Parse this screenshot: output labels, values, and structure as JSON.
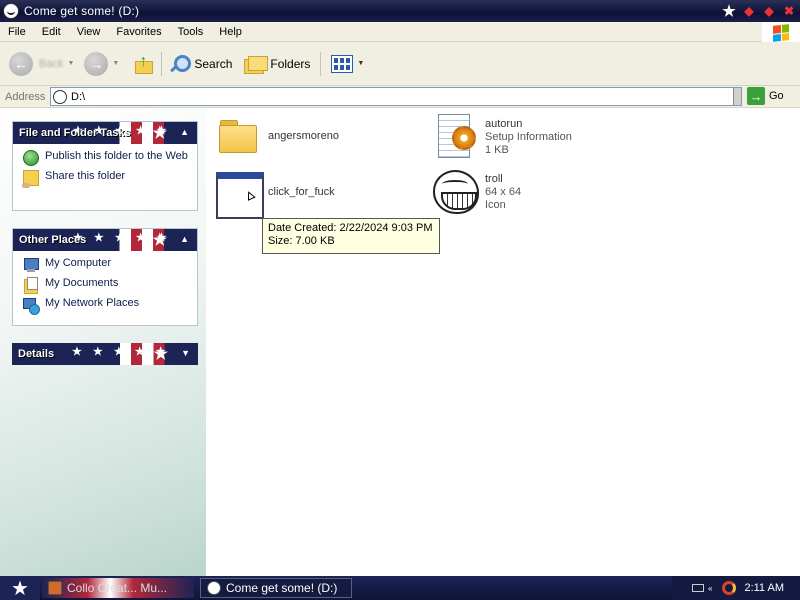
{
  "window": {
    "title": "Come get some! (D:)"
  },
  "menu": [
    "File",
    "Edit",
    "View",
    "Favorites",
    "Tools",
    "Help"
  ],
  "toolbar": {
    "back_label": "Back",
    "search_label": "Search",
    "folders_label": "Folders"
  },
  "address": {
    "label": "Address",
    "value": "D:\\",
    "go_label": "Go"
  },
  "taskpane": {
    "file_folder_tasks": {
      "title": "File and Folder Tasks",
      "items": [
        "Publish this folder to the Web",
        "Share this folder"
      ]
    },
    "other_places": {
      "title": "Other Places",
      "items": [
        "My Computer",
        "My Documents",
        "My Network Places"
      ]
    },
    "details": {
      "title": "Details"
    }
  },
  "files": [
    {
      "name": "angersmoreno",
      "type": "folder"
    },
    {
      "name": "autorun",
      "meta1": "Setup Information",
      "meta2": "1 KB",
      "type": "inf"
    },
    {
      "name": "click_for_fuck",
      "type": "exe"
    },
    {
      "name": "troll",
      "meta1": "64 x 64",
      "meta2": "Icon",
      "type": "icon"
    }
  ],
  "tooltip": {
    "line1": "Date Created: 2/22/2024 9:03 PM",
    "line2": "Size: 7.00 KB"
  },
  "taskbar": {
    "tasks": [
      {
        "label": "Collo Creat... Mu...",
        "active": false
      },
      {
        "label": "Come get some! (D:)",
        "active": true
      }
    ],
    "clock": "2:11 AM"
  },
  "colors": {
    "title_bar": "#0e1236",
    "panel_header_blue": "#1c2456",
    "panel_header_red": "#b0283a",
    "tooltip_bg": "#ffffe1"
  }
}
